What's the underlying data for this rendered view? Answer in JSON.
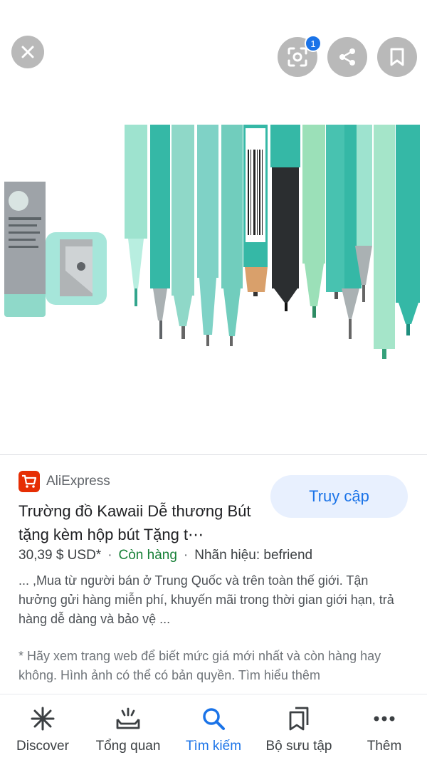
{
  "viewer": {
    "close_icon": "close-icon",
    "lens_icon": "lens-icon",
    "lens_badge": "1",
    "share_icon": "share-icon",
    "save_icon": "bookmark-icon",
    "product_image_desc": "mint green pens, pencils, eraser and sharpener"
  },
  "result": {
    "source": "AliExpress",
    "source_color": "#e62e04",
    "title": "Trường đồ Kawaii Dễ thương Bút tặng kèm hộp bút Tặng t⋯",
    "price": "30,39 $ USD*",
    "stock": "Còn hàng",
    "brand": "Nhãn hiệu: befriend",
    "description": "... ,Mua từ người bán ở Trung Quốc và trên toàn thế giới. Tận hưởng gửi hàng miễn phí, khuyến mãi trong thời gian giới hạn, trả hàng dễ dàng và bảo vệ ...",
    "disclaimer": "* Hãy xem trang web để biết mức giá mới nhất và còn hàng hay không. Hình ảnh có thể có bản quyền. Tìm hiểu thêm",
    "visit_label": "Truy cập"
  },
  "nav": {
    "items": [
      {
        "label": "Discover",
        "icon": "asterisk-icon"
      },
      {
        "label": "Tổng quan",
        "icon": "tray-icon"
      },
      {
        "label": "Tìm kiếm",
        "icon": "search-icon",
        "active": true
      },
      {
        "label": "Bộ sưu tập",
        "icon": "collections-icon"
      },
      {
        "label": "Thêm",
        "icon": "more-icon"
      }
    ]
  },
  "colors": {
    "accent": "#1a73e8",
    "in_stock": "#188038",
    "accent_light": "#e8f0fe"
  }
}
